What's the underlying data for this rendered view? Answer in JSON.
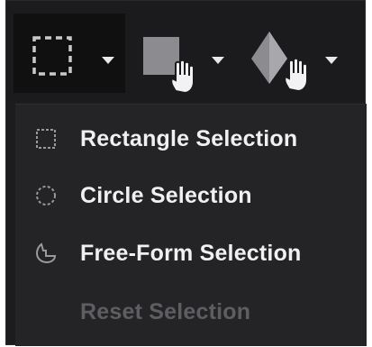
{
  "toolbar": {
    "tools": [
      {
        "icon": "rectangle-selection-tool-icon",
        "has_dropdown": true,
        "active": true
      },
      {
        "icon": "shape-hand-tool-icon",
        "has_dropdown": true,
        "active": false
      },
      {
        "icon": "polygon-hand-tool-icon",
        "has_dropdown": true,
        "active": false
      }
    ]
  },
  "menu": {
    "items": [
      {
        "label": "Rectangle Selection",
        "icon": "rectangle-selection-icon",
        "enabled": true
      },
      {
        "label": "Circle Selection",
        "icon": "circle-selection-icon",
        "enabled": true
      },
      {
        "label": "Free-Form Selection",
        "icon": "freeform-selection-icon",
        "enabled": true
      },
      {
        "label": "Reset Selection",
        "icon": "",
        "enabled": false
      }
    ]
  },
  "colors": {
    "background": "#1c1c1e",
    "menu_background": "#242426",
    "text": "#f0f0f2",
    "text_disabled": "#5e5e62",
    "icon": "#9a9a9e"
  }
}
